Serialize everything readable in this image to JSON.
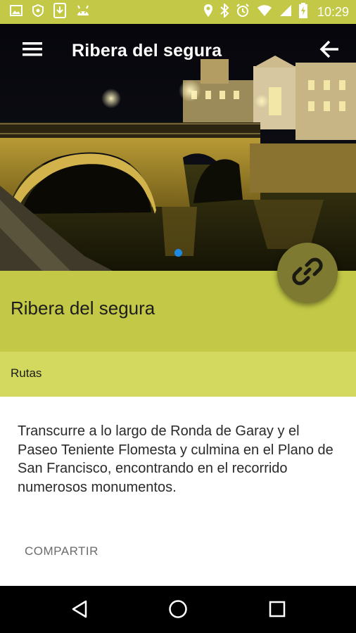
{
  "status_bar": {
    "time": "10:29",
    "icons": [
      "image-icon",
      "shield-icon",
      "download-icon",
      "android-icon",
      "location-icon",
      "bluetooth-icon",
      "alarm-icon",
      "wifi-icon",
      "signal-icon",
      "battery-charging-icon"
    ]
  },
  "app_bar": {
    "title": "Ribera del segura",
    "menu_icon": "menu-icon",
    "back_icon": "arrow-back-icon"
  },
  "hero": {
    "description_icon": "night-bridge-photo",
    "carousel_pages": 1,
    "active_page": 1
  },
  "detail": {
    "title": "Ribera del segura",
    "category": "Rutas",
    "description": "Transcurre a lo largo de Ronda de Garay y el Paseo Teniente Flomesta y culmina en el Plano de San Francisco, encontrando en el recorrido numerosos monumentos.",
    "share_label": "COMPARTIR",
    "fab_icon": "link-icon"
  },
  "nav_bar": {
    "icons": [
      "back-triangle-icon",
      "home-circle-icon",
      "recents-square-icon"
    ]
  },
  "colors": {
    "accent": "#c3c946",
    "accent_light": "#d3d85f",
    "fab": "#7e7a32",
    "page_indicator": "#1e88e5"
  }
}
